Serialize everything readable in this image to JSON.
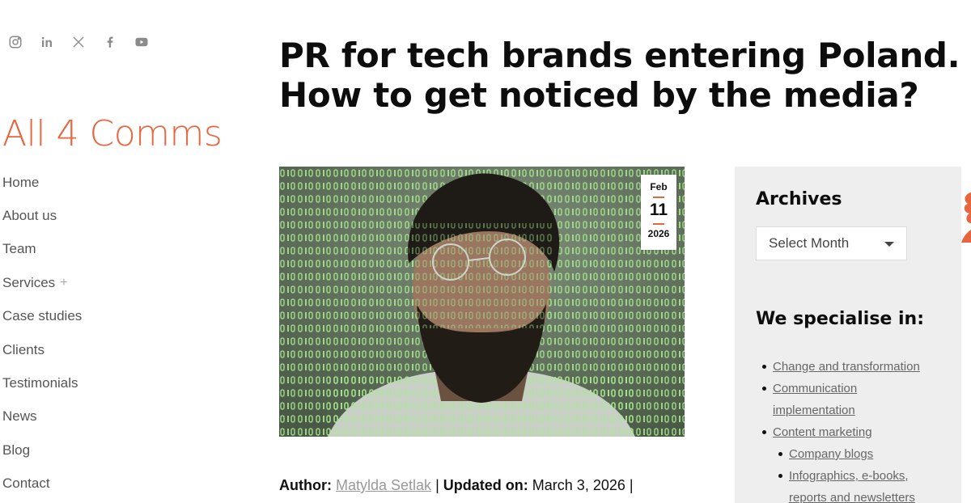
{
  "social": [
    {
      "name": "instagram-icon"
    },
    {
      "name": "linkedin-icon"
    },
    {
      "name": "x-icon"
    },
    {
      "name": "facebook-icon"
    },
    {
      "name": "youtube-icon"
    }
  ],
  "brand": {
    "logo_text": "All 4 Comms",
    "accent": "#e8663f"
  },
  "nav": {
    "items": [
      "Home",
      "About us",
      "Team",
      "Services",
      "Case studies",
      "Clients",
      "Testimonials",
      "News",
      "Blog",
      "Contact"
    ],
    "services_expand": "+"
  },
  "article": {
    "title_line1": "PR for tech brands entering Poland.",
    "title_line2": "How to get noticed by the media?",
    "date": {
      "month": "Feb",
      "day": "11",
      "year": "2026"
    },
    "author_label": "Author:",
    "author_name": "Matylda Setlak",
    "separator": "|",
    "updated_label": "Updated on:",
    "updated_date": "March 3, 2026"
  },
  "sidebar": {
    "archives_heading": "Archives",
    "archives_select": "Select Month",
    "specialise_heading": "We specialise in:",
    "items": [
      {
        "label": "Change and transformation"
      },
      {
        "label": "Communication"
      },
      {
        "label": "implementation"
      },
      {
        "label": "Content marketing"
      },
      {
        "label": "Company blogs"
      },
      {
        "label": "Infographics, e-books,"
      },
      {
        "label": "reports and newsletters"
      }
    ]
  }
}
